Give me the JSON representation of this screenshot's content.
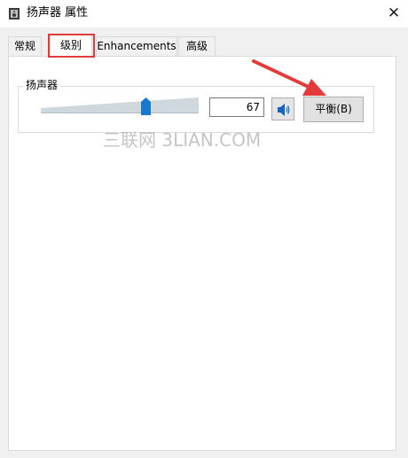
{
  "window": {
    "title": "扬声器 属性",
    "close_symbol": "✕",
    "app_icon": "speaker-properties-icon"
  },
  "tabs": [
    {
      "label": "常规",
      "selected": false
    },
    {
      "label": "级别",
      "selected": true
    },
    {
      "label": "Enhancements",
      "selected": false
    },
    {
      "label": "高级",
      "selected": false
    }
  ],
  "levels": {
    "group_label": "扬声器",
    "volume_value": "67",
    "volume_level_percent": 67,
    "speaker_icon": "speaker-volume-icon",
    "balance_button_label": "平衡(B)"
  },
  "annotations": {
    "highlight_color": "#e33b3b",
    "arrow_color": "#e33b3b"
  },
  "watermark": {
    "text": "三联网 3LIAN.COM"
  },
  "colors": {
    "slider_thumb": "#1979ca",
    "slider_track": "#cfd8dc"
  }
}
